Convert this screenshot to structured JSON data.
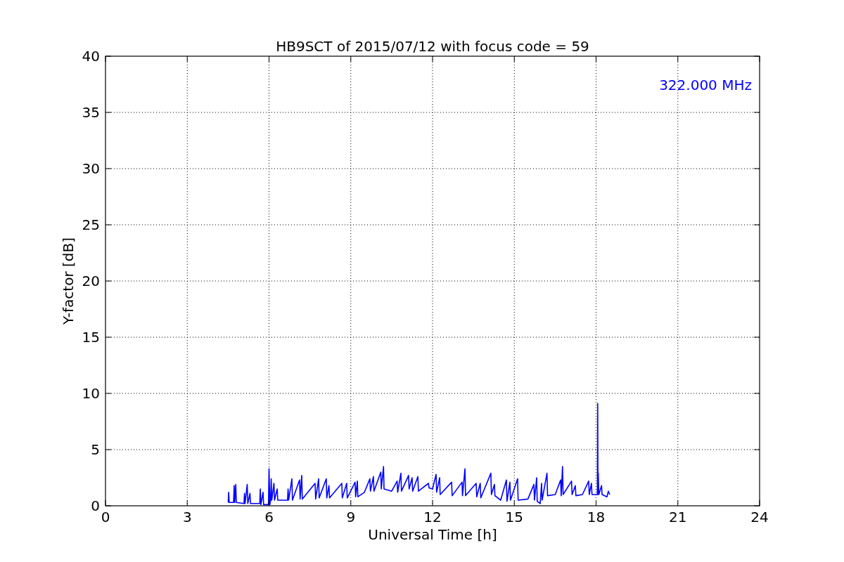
{
  "figure": {
    "chart_data": {
      "type": "line",
      "title": "HB9SCT of 2015/07/12 with focus code = 59",
      "xlabel": "Universal Time [h]",
      "ylabel": "Y-factor [dB]",
      "xlim": [
        0,
        24
      ],
      "ylim": [
        0,
        40
      ],
      "grid": true,
      "xticks": [
        0,
        3,
        6,
        9,
        12,
        15,
        18,
        21,
        24
      ],
      "yticks": [
        0,
        5,
        10,
        15,
        20,
        25,
        30,
        35,
        40
      ],
      "x": [
        4.5,
        4.52,
        4.54,
        4.7,
        4.72,
        4.74,
        4.78,
        4.8,
        5.08,
        5.1,
        5.12,
        5.2,
        5.22,
        5.3,
        5.32,
        5.66,
        5.68,
        5.7,
        5.78,
        5.8,
        5.98,
        6.0,
        6.03,
        6.06,
        6.08,
        6.1,
        6.18,
        6.2,
        6.3,
        6.32,
        6.68,
        6.7,
        6.72,
        6.84,
        6.86,
        7.12,
        7.14,
        7.2,
        7.22,
        7.69,
        7.71,
        7.82,
        7.84,
        8.1,
        8.12,
        8.2,
        8.22,
        8.67,
        8.69,
        8.85,
        8.87,
        9.16,
        9.18,
        9.24,
        9.26,
        9.5,
        9.7,
        9.72,
        9.83,
        9.85,
        10.1,
        10.12,
        10.2,
        10.22,
        10.5,
        10.7,
        10.72,
        10.84,
        10.86,
        11.12,
        11.14,
        11.25,
        11.27,
        11.46,
        11.48,
        11.85,
        11.87,
        12.0,
        12.13,
        12.15,
        12.26,
        12.28,
        12.7,
        12.72,
        13.08,
        13.1,
        13.19,
        13.21,
        13.6,
        13.62,
        13.75,
        13.77,
        14.14,
        14.16,
        14.27,
        14.29,
        14.5,
        14.71,
        14.73,
        14.84,
        14.86,
        15.12,
        15.14,
        15.5,
        15.72,
        15.74,
        15.82,
        15.84,
        15.95,
        16.0,
        16.02,
        16.2,
        16.22,
        16.5,
        16.7,
        16.72,
        16.77,
        16.79,
        17.1,
        17.12,
        17.24,
        17.26,
        17.5,
        17.73,
        17.75,
        17.83,
        17.85,
        18.05,
        18.06,
        18.07,
        18.08,
        18.1,
        18.2,
        18.22,
        18.4,
        18.45,
        18.5
      ],
      "series": [
        {
          "color": "#0000ff",
          "values": [
            0.3,
            1.2,
            0.3,
            0.3,
            1.8,
            0.3,
            1.9,
            0.3,
            0.2,
            1.1,
            0.2,
            1.9,
            0.2,
            1.1,
            0.2,
            0.2,
            1.5,
            0.1,
            1.2,
            0.1,
            0.1,
            3.3,
            0.1,
            0.5,
            2.4,
            0.5,
            2.0,
            0.5,
            1.5,
            0.5,
            0.5,
            1.5,
            0.5,
            2.4,
            0.5,
            2.3,
            0.6,
            2.7,
            0.6,
            2.0,
            0.6,
            2.4,
            0.7,
            2.4,
            0.7,
            1.8,
            0.7,
            2.0,
            0.7,
            2.0,
            0.7,
            2.1,
            0.8,
            2.2,
            0.8,
            1.2,
            2.4,
            1.3,
            2.6,
            1.3,
            3.0,
            1.5,
            3.5,
            1.5,
            1.3,
            2.2,
            1.2,
            2.9,
            1.3,
            2.7,
            1.5,
            2.5,
            1.3,
            2.6,
            1.3,
            2.0,
            1.6,
            1.5,
            2.8,
            1.2,
            2.5,
            1.0,
            2.1,
            0.9,
            2.1,
            0.9,
            3.3,
            0.9,
            2.0,
            0.8,
            2.0,
            0.7,
            2.9,
            1.0,
            1.9,
            0.9,
            0.5,
            2.3,
            0.4,
            2.1,
            0.5,
            2.4,
            0.5,
            0.6,
            1.9,
            0.5,
            2.5,
            0.4,
            0.2,
            2.0,
            0.5,
            2.9,
            0.9,
            1.0,
            2.3,
            0.9,
            3.5,
            1.0,
            2.2,
            1.0,
            1.8,
            0.9,
            1.0,
            2.2,
            1.0,
            2.0,
            1.0,
            1.0,
            9.1,
            1.0,
            2.9,
            1.0,
            1.8,
            1.0,
            0.8,
            1.3,
            1.0
          ]
        }
      ],
      "annotations": [
        {
          "text": "322.000 MHz"
        }
      ]
    }
  }
}
